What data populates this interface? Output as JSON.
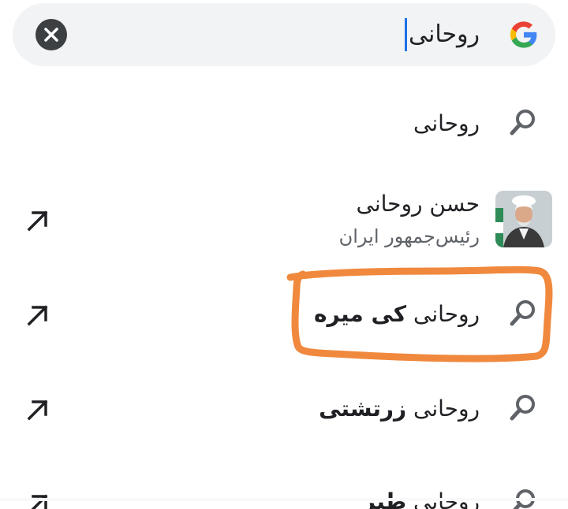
{
  "search": {
    "query": "روحانی",
    "clear_icon": "close-icon",
    "logo_icon": "google-g-logo"
  },
  "suggestions": [
    {
      "type": "query",
      "text": "روحانی",
      "icon": "search-icon",
      "has_arrow": false
    },
    {
      "type": "entity",
      "title": "حسن روحانی",
      "subtitle": "رئیس‌جمهور ایران",
      "icon": "avatar",
      "has_arrow": true
    },
    {
      "type": "query",
      "prefix": "روحانی",
      "completion": "کی میره",
      "icon": "search-icon",
      "has_arrow": true,
      "highlighted": true
    },
    {
      "type": "query",
      "prefix": "روحانی",
      "completion": "زرتشتی",
      "icon": "search-icon",
      "has_arrow": true
    },
    {
      "type": "query",
      "prefix": "روحانی",
      "completion": "طنز",
      "icon": "search-icon",
      "has_arrow": true
    }
  ],
  "colors": {
    "bar_bg": "#f1f3f4",
    "caret": "#1a73e8",
    "highlight_stroke": "#f0893e",
    "icon_gray": "#5f6368"
  }
}
